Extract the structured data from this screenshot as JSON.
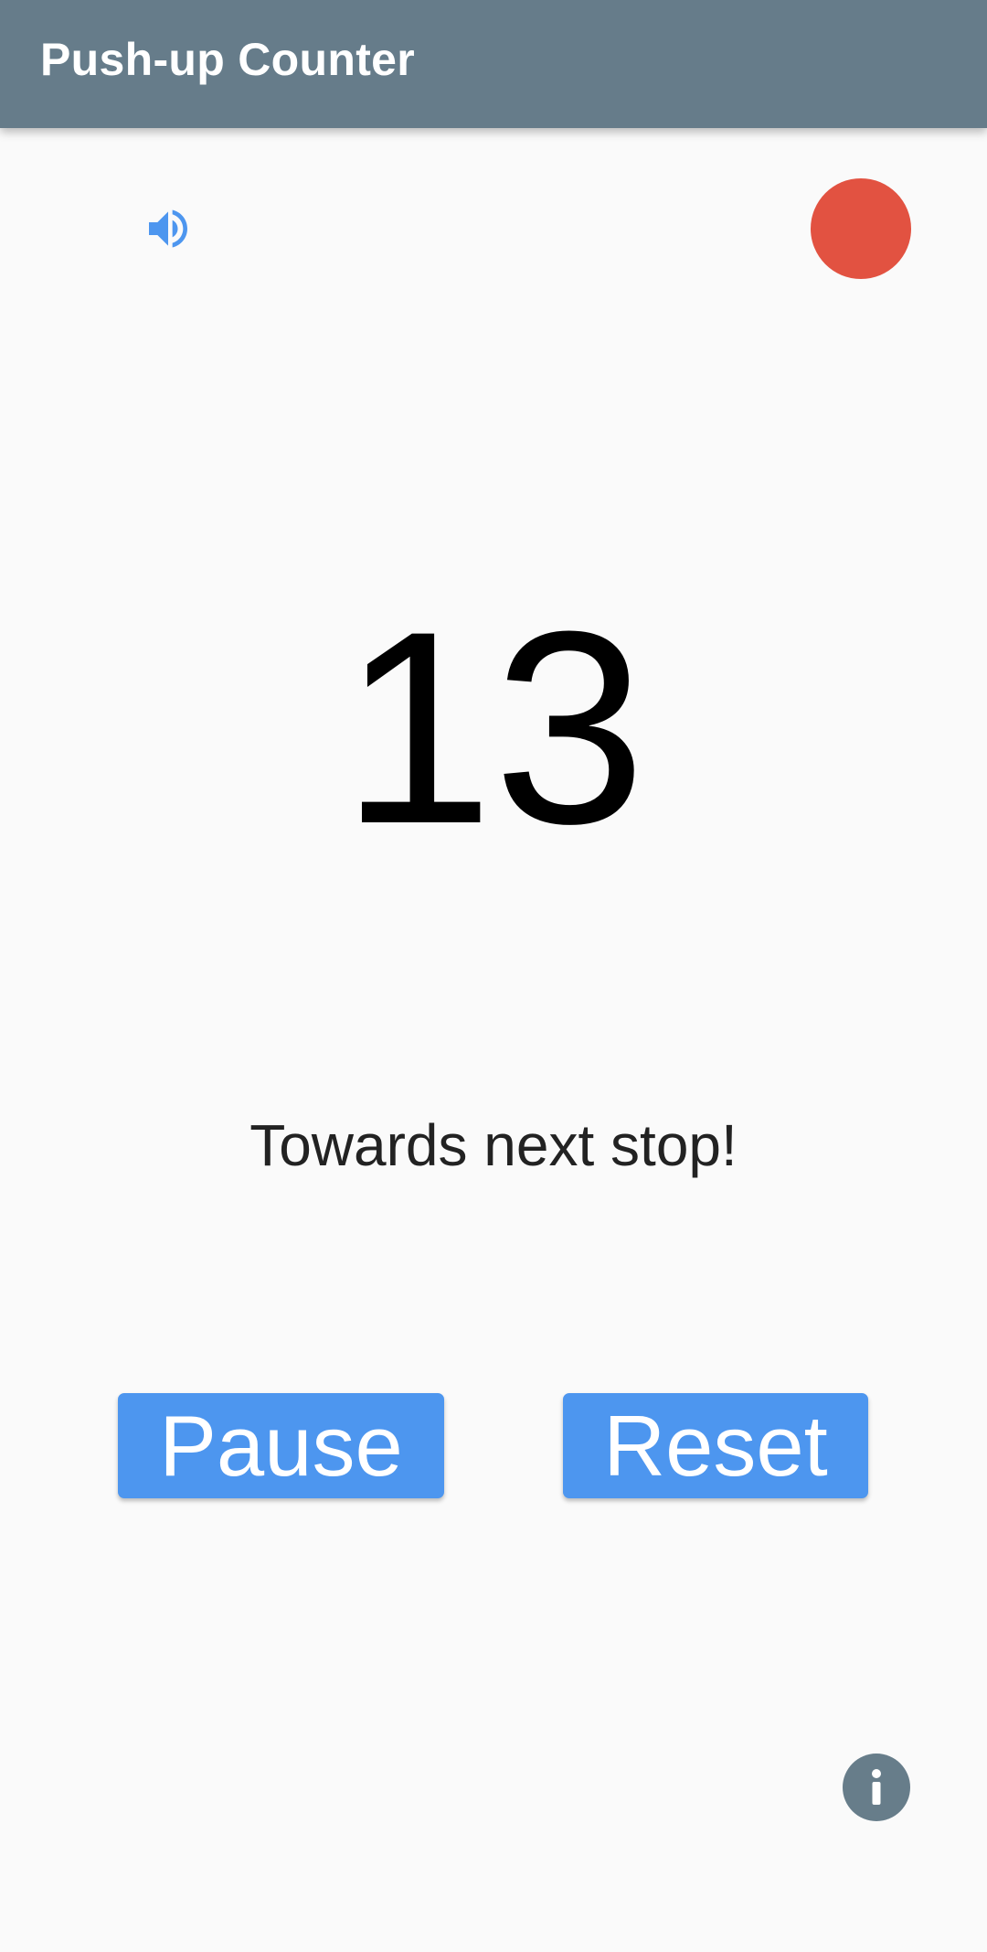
{
  "app_bar": {
    "title": "Push-up Counter"
  },
  "controls": {
    "sound_icon": "volume-up-icon",
    "record_indicator_icon": "record-dot",
    "info_icon": "info-icon"
  },
  "counter": {
    "value": "13"
  },
  "status": {
    "message": "Towards next stop!"
  },
  "buttons": {
    "pause_label": "Pause",
    "reset_label": "Reset"
  },
  "colors": {
    "app_bar": "#667c8a",
    "accent_blue": "#4d96ef",
    "record_red": "#e25241",
    "info_grey": "#677d8a",
    "background": "#fafafa"
  }
}
